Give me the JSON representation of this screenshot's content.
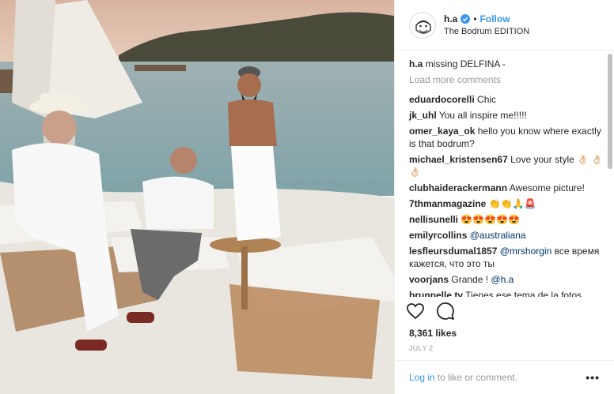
{
  "post": {
    "username": "h.a",
    "separator": "•",
    "follow_label": "Follow",
    "location": "The Bodrum EDITION",
    "caption_user": "h.a",
    "caption_text": "missing DELFINA -",
    "load_more": "Load more comments",
    "comments": [
      {
        "user": "eduardocorelli",
        "text": "Chic"
      },
      {
        "user": "jk_uhl",
        "text": "You all inspire me!!!!!"
      },
      {
        "user": "omer_kaya_ok",
        "text": "hello you know where exactly is that bodrum?"
      },
      {
        "user": "michael_kristensen67",
        "text": "Love your style 👌🏻 👌🏻 👌🏻"
      },
      {
        "user": "clubhaiderackermann",
        "text": "Awesome picture!"
      },
      {
        "user": "7thmanmagazine",
        "text": "👏👏🙏🚨"
      },
      {
        "user": "nellisunelli",
        "text": "😍😍😍😍😍"
      },
      {
        "user": "emilyrcollins",
        "mention": "@australiana"
      },
      {
        "user": "lesfleursdumal1857",
        "mention": "@mrshorgin",
        "text": "все время кажется, что это ты"
      },
      {
        "user": "voorjans",
        "text": "Grande !",
        "mention": "@h.a"
      },
      {
        "user": "brunpelle.tv",
        "text": "Tienes ese tema de la fotos"
      }
    ],
    "likes": "8,361 likes",
    "date": "JULY 2",
    "login_link": "Log in",
    "login_rest": "to like or comment.",
    "more_options": "•••",
    "icons": [
      "heart-icon",
      "comment-icon",
      "verified-icon",
      "more-options-icon"
    ],
    "colors": {
      "accent": "#3897f0",
      "muted": "#999999",
      "text": "#262626"
    }
  }
}
